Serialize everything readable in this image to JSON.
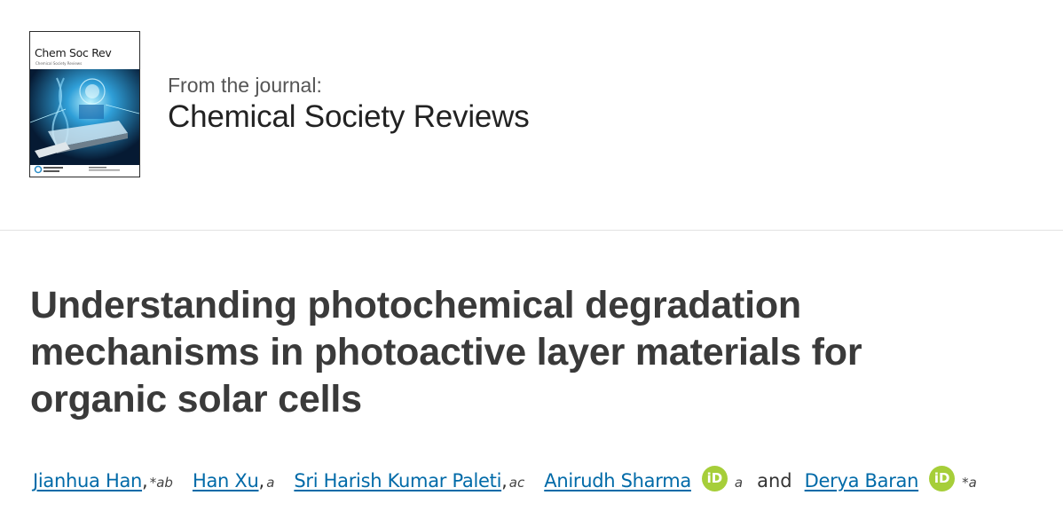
{
  "journal": {
    "cover_title": "Chem Soc Rev",
    "cover_subtitle": "Chemical Society Reviews",
    "label": "From the journal:",
    "name": "Chemical Society Reviews"
  },
  "article": {
    "title": "Understanding photochemical degradation mechanisms in photoactive layer materials for organic solar cells"
  },
  "authors": [
    {
      "name": "Jianhua Han",
      "affiliation": "*ab",
      "separator": ",",
      "orcid": false
    },
    {
      "name": "Han Xu",
      "affiliation": "a",
      "separator": ",",
      "orcid": false
    },
    {
      "name": "Sri Harish Kumar Paleti",
      "affiliation": "ac",
      "separator": ",",
      "orcid": false
    },
    {
      "name": "Anirudh Sharma",
      "affiliation": "a",
      "separator": "",
      "orcid": true
    },
    {
      "name": "Derya Baran",
      "affiliation": "*a",
      "separator": "",
      "orcid": true
    }
  ],
  "and_word": "and",
  "orcid_icon_text": "iD",
  "colors": {
    "link": "#006aa8",
    "orcid": "#a6ce39",
    "title": "#3a3a3a"
  }
}
